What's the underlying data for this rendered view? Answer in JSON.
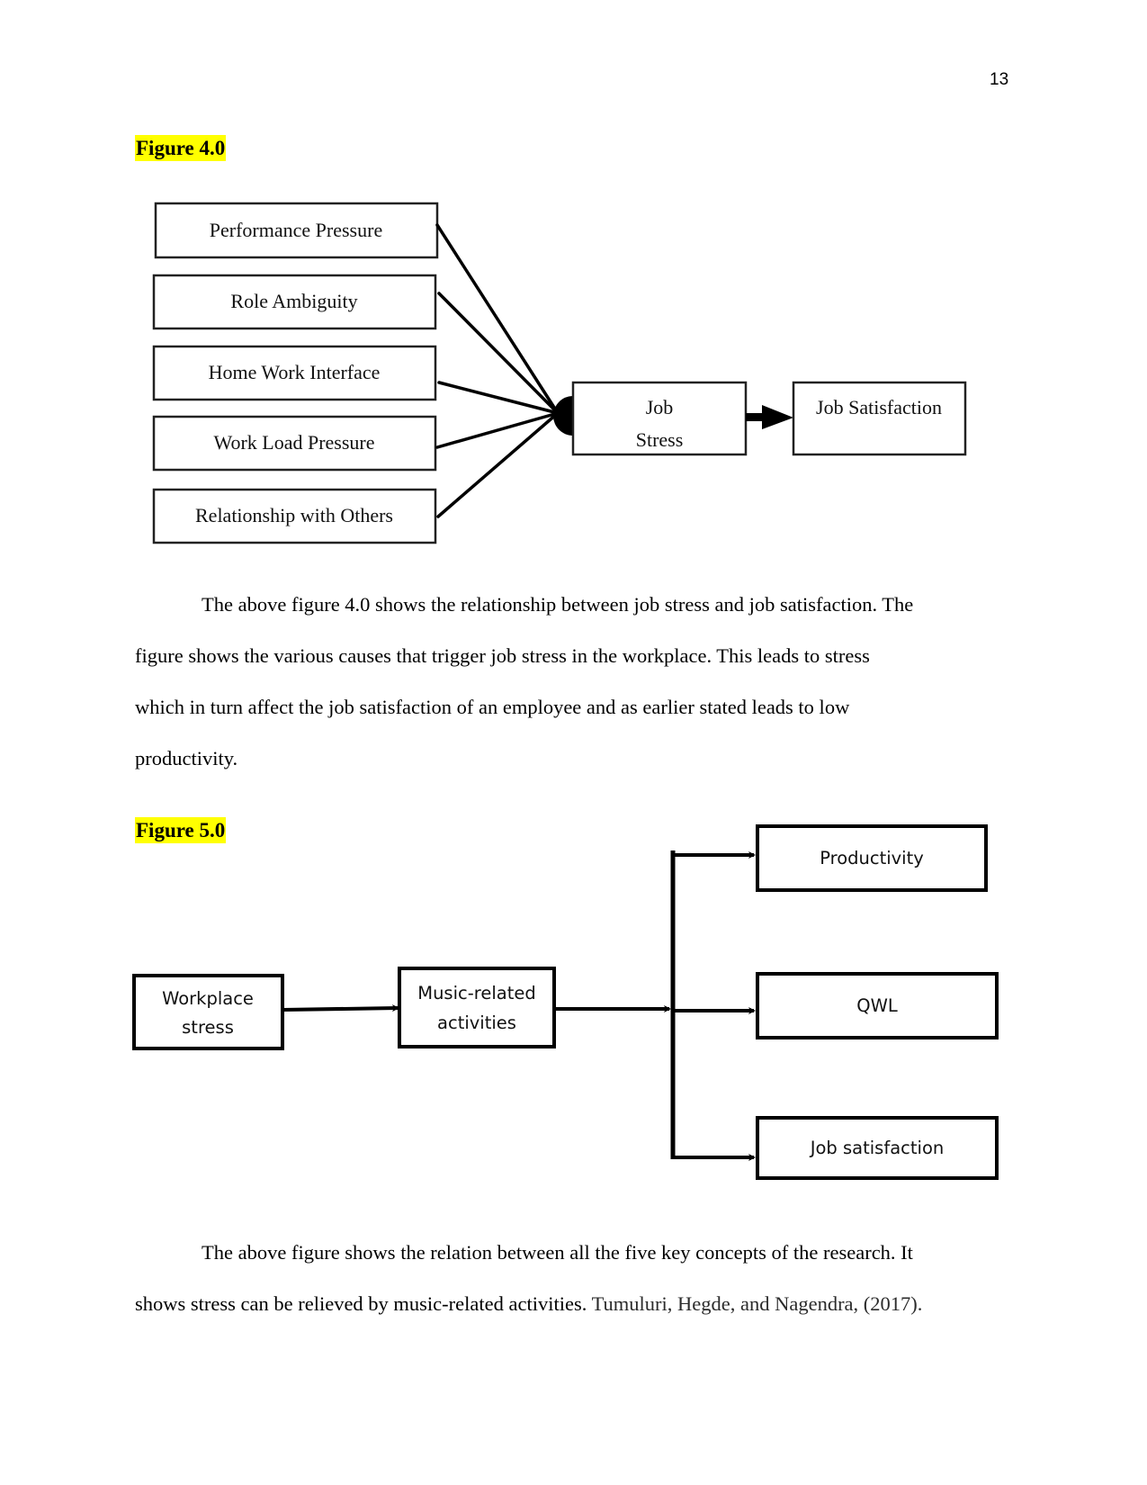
{
  "page_number": "13",
  "figure1": {
    "label": "Figure 4.0",
    "causes": [
      "Performance Pressure",
      "Role Ambiguity",
      "Home Work Interface",
      "Work Load Pressure",
      "Relationship with Others"
    ],
    "center": {
      "line1": "Job",
      "line2": "Stress"
    },
    "outcome": "Job Satisfaction"
  },
  "paragraph1": {
    "line1": "The above figure 4.0 shows the relationship between job stress and job satisfaction. The",
    "line2": "figure shows the various causes that trigger job stress in the workplace. This leads to stress",
    "line3": "which in turn affect the job satisfaction of an employee and as earlier stated leads to low",
    "line4": "productivity."
  },
  "figure2": {
    "label": "Figure 5.0",
    "source": {
      "line1": "Workplace",
      "line2": "stress"
    },
    "mediator": {
      "line1": "Music-related",
      "line2": "activities"
    },
    "outcomes": [
      "Productivity",
      "QWL",
      "Job satisfaction"
    ]
  },
  "paragraph2": {
    "line1": "The above figure shows the relation between all the five key concepts of the research. It",
    "line2_text": "shows stress can be relieved by music-related activities.",
    "line2_citation": "Tumuluri, Hegde, and Nagendra, (2017)."
  },
  "colors": {
    "highlight": "#ffff00",
    "citation": "#2b2b2b"
  }
}
